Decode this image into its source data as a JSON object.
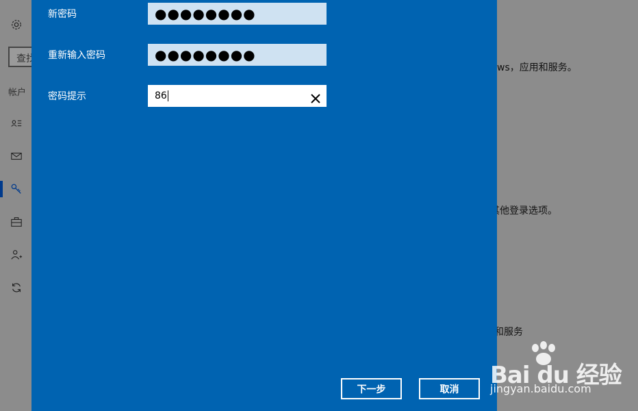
{
  "sidebar": {
    "search_partial": "查找",
    "header": "帐户",
    "icons": [
      "gear-icon",
      "contact-card-icon",
      "mail-icon",
      "key-icon",
      "briefcase-icon",
      "add-person-icon",
      "sync-icon"
    ]
  },
  "background": {
    "text1": "ws，应用和服务。",
    "text2": "其他登录选项。",
    "text3": "和服务"
  },
  "dialog": {
    "new_password_label": "新密码",
    "new_password_value": "●●●●●●●●",
    "reenter_password_label": "重新输入密码",
    "reenter_password_value": "●●●●●●●●",
    "hint_label": "密码提示",
    "hint_value": "86",
    "next_button": "下一步",
    "cancel_button": "取消"
  },
  "watermark": {
    "logo": "Bai du 经验",
    "url": "jingyan.baidu.com"
  },
  "colors": {
    "dialog_bg": "#0063b1",
    "password_field_bg": "#cfe2f2",
    "dim_bg": "#8c8c8c"
  }
}
